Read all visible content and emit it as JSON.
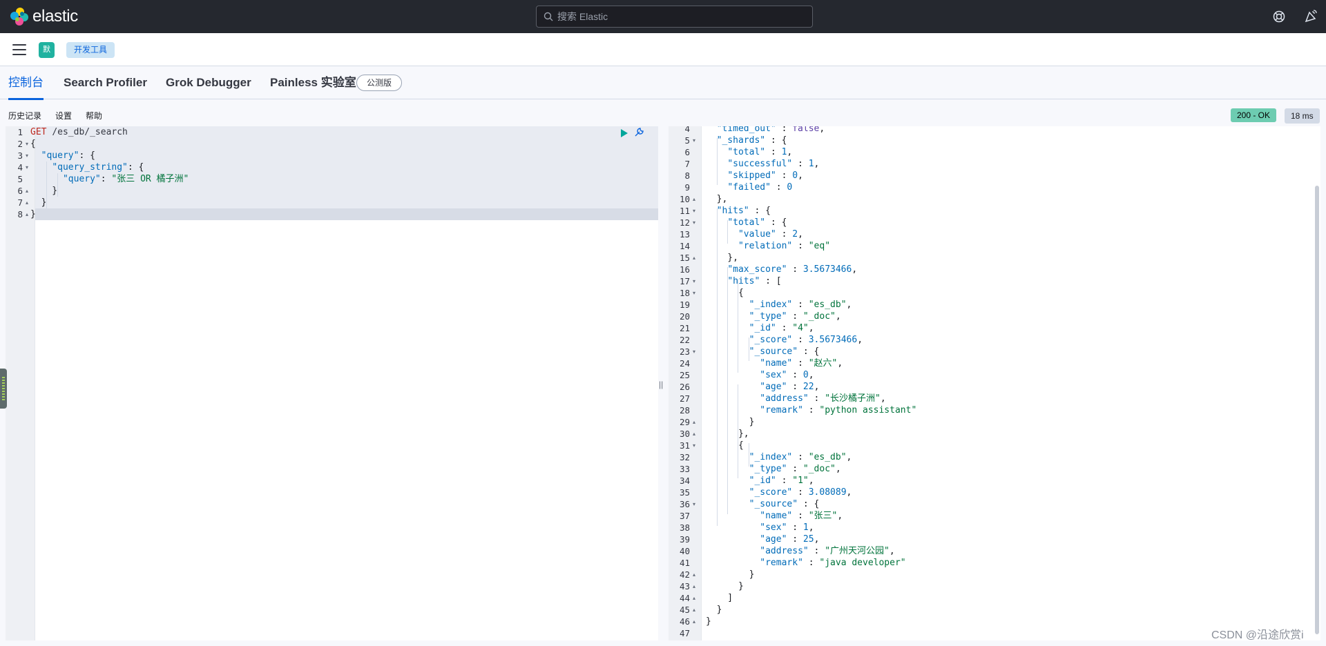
{
  "header": {
    "brand": "elastic",
    "search_placeholder": "搜索 Elastic",
    "icons": [
      "help-icon",
      "newsfeed-icon"
    ]
  },
  "breadcrumb": {
    "space_badge": "默",
    "current": "开发工具"
  },
  "tabs": [
    {
      "label": "控制台",
      "active": true
    },
    {
      "label": "Search Profiler",
      "active": false
    },
    {
      "label": "Grok Debugger",
      "active": false
    },
    {
      "label": "Painless 实验室",
      "active": false
    }
  ],
  "beta_badge": "公测版",
  "menu": {
    "history": "历史记录",
    "settings": "设置",
    "help": "帮助"
  },
  "response_status": {
    "code": "200 - OK",
    "time": "18 ms"
  },
  "request": {
    "lines": [
      {
        "n": "1",
        "fold": "",
        "text": "GET /es_db/_search"
      },
      {
        "n": "2",
        "fold": "down",
        "text": "{"
      },
      {
        "n": "3",
        "fold": "down",
        "text": "  \"query\": {"
      },
      {
        "n": "4",
        "fold": "down",
        "text": "    \"query_string\": {"
      },
      {
        "n": "5",
        "fold": "",
        "text": "      \"query\": \"张三 OR 橘子洲\""
      },
      {
        "n": "6",
        "fold": "up",
        "text": "    }"
      },
      {
        "n": "7",
        "fold": "up",
        "text": "  }"
      },
      {
        "n": "8",
        "fold": "up",
        "text": "}"
      }
    ]
  },
  "response": {
    "lines": [
      {
        "n": "4",
        "fold": "",
        "text": "  \"timed_out\" : false,"
      },
      {
        "n": "5",
        "fold": "down",
        "text": "  \"_shards\" : {"
      },
      {
        "n": "6",
        "fold": "",
        "text": "    \"total\" : 1,"
      },
      {
        "n": "7",
        "fold": "",
        "text": "    \"successful\" : 1,"
      },
      {
        "n": "8",
        "fold": "",
        "text": "    \"skipped\" : 0,"
      },
      {
        "n": "9",
        "fold": "",
        "text": "    \"failed\" : 0"
      },
      {
        "n": "10",
        "fold": "up",
        "text": "  },"
      },
      {
        "n": "11",
        "fold": "down",
        "text": "  \"hits\" : {"
      },
      {
        "n": "12",
        "fold": "down",
        "text": "    \"total\" : {"
      },
      {
        "n": "13",
        "fold": "",
        "text": "      \"value\" : 2,"
      },
      {
        "n": "14",
        "fold": "",
        "text": "      \"relation\" : \"eq\""
      },
      {
        "n": "15",
        "fold": "up",
        "text": "    },"
      },
      {
        "n": "16",
        "fold": "",
        "text": "    \"max_score\" : 3.5673466,"
      },
      {
        "n": "17",
        "fold": "down",
        "text": "    \"hits\" : ["
      },
      {
        "n": "18",
        "fold": "down",
        "text": "      {"
      },
      {
        "n": "19",
        "fold": "",
        "text": "        \"_index\" : \"es_db\","
      },
      {
        "n": "20",
        "fold": "",
        "text": "        \"_type\" : \"_doc\","
      },
      {
        "n": "21",
        "fold": "",
        "text": "        \"_id\" : \"4\","
      },
      {
        "n": "22",
        "fold": "",
        "text": "        \"_score\" : 3.5673466,"
      },
      {
        "n": "23",
        "fold": "down",
        "text": "        \"_source\" : {"
      },
      {
        "n": "24",
        "fold": "",
        "text": "          \"name\" : \"赵六\","
      },
      {
        "n": "25",
        "fold": "",
        "text": "          \"sex\" : 0,"
      },
      {
        "n": "26",
        "fold": "",
        "text": "          \"age\" : 22,"
      },
      {
        "n": "27",
        "fold": "",
        "text": "          \"address\" : \"长沙橘子洲\","
      },
      {
        "n": "28",
        "fold": "",
        "text": "          \"remark\" : \"python assistant\""
      },
      {
        "n": "29",
        "fold": "up",
        "text": "        }"
      },
      {
        "n": "30",
        "fold": "up",
        "text": "      },"
      },
      {
        "n": "31",
        "fold": "down",
        "text": "      {"
      },
      {
        "n": "32",
        "fold": "",
        "text": "        \"_index\" : \"es_db\","
      },
      {
        "n": "33",
        "fold": "",
        "text": "        \"_type\" : \"_doc\","
      },
      {
        "n": "34",
        "fold": "",
        "text": "        \"_id\" : \"1\","
      },
      {
        "n": "35",
        "fold": "",
        "text": "        \"_score\" : 3.08089,"
      },
      {
        "n": "36",
        "fold": "down",
        "text": "        \"_source\" : {"
      },
      {
        "n": "37",
        "fold": "",
        "text": "          \"name\" : \"张三\","
      },
      {
        "n": "38",
        "fold": "",
        "text": "          \"sex\" : 1,"
      },
      {
        "n": "39",
        "fold": "",
        "text": "          \"age\" : 25,"
      },
      {
        "n": "40",
        "fold": "",
        "text": "          \"address\" : \"广州天河公园\","
      },
      {
        "n": "41",
        "fold": "",
        "text": "          \"remark\" : \"java developer\""
      },
      {
        "n": "42",
        "fold": "up",
        "text": "        }"
      },
      {
        "n": "43",
        "fold": "up",
        "text": "      }"
      },
      {
        "n": "44",
        "fold": "up",
        "text": "    ]"
      },
      {
        "n": "45",
        "fold": "up",
        "text": "  }"
      },
      {
        "n": "46",
        "fold": "up",
        "text": "}"
      },
      {
        "n": "47",
        "fold": "",
        "text": ""
      }
    ]
  },
  "watermark": "CSDN @沿途欣赏i"
}
